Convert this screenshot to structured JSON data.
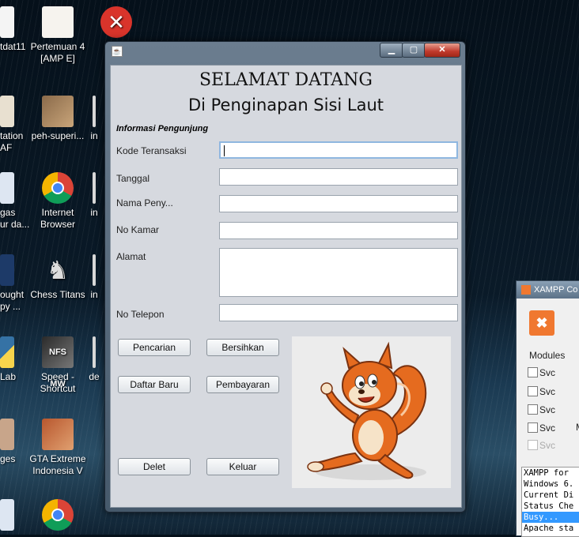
{
  "desktop": {
    "icons": [
      {
        "label": "tdat11",
        "x": "—"
      },
      {
        "label": "Pertemuan 4\n[AMP E]"
      },
      {
        "label": "in"
      },
      {
        "label": "tation\nAF"
      },
      {
        "label": "peh-superi..."
      },
      {
        "label": "in"
      },
      {
        "label": "gas\nur da..."
      },
      {
        "label": "Internet\nBrowser"
      },
      {
        "label": "in"
      },
      {
        "label": "ought\npy ..."
      },
      {
        "label": "Chess Titans"
      },
      {
        "label": "in"
      },
      {
        "label": "Lab"
      },
      {
        "label": "Speed -\nShortcut"
      },
      {
        "label": "de"
      },
      {
        "label": "ges"
      },
      {
        "label": "GTA Extreme\nIndonesia V"
      }
    ]
  },
  "app": {
    "heading": "SELAMAT DATANG",
    "subheading": "Di Penginapan Sisi Laut",
    "section": "Informasi Pengunjung",
    "fields": {
      "kode": {
        "label": "Kode Teransaksi",
        "value": ""
      },
      "tanggal": {
        "label": "Tanggal",
        "value": ""
      },
      "nama": {
        "label": "Nama Peny...",
        "value": ""
      },
      "kamar": {
        "label": "No Kamar",
        "value": ""
      },
      "alamat": {
        "label": "Alamat",
        "value": ""
      },
      "telepon": {
        "label": "No Telepon",
        "value": ""
      }
    },
    "buttons": {
      "pencarian": "Pencarian",
      "bersihkan": "Bersihkan",
      "daftar_baru": "Daftar Baru",
      "pembayaran": "Pembayaran",
      "delet": "Delet",
      "keluar": "Keluar"
    },
    "title_buttons": {
      "minimize": "▁",
      "maximize": "▢",
      "close": "✕"
    }
  },
  "xampp": {
    "title": "XAMPP Co",
    "modules_label": "Modules",
    "services": [
      "Svc",
      "Svc",
      "Svc",
      "Svc",
      "Svc"
    ],
    "side_letter": "M",
    "log": [
      "XAMPP for",
      "Windows 6.",
      "Current Di",
      "Status Che",
      "Busy...",
      "Apache sta"
    ]
  }
}
